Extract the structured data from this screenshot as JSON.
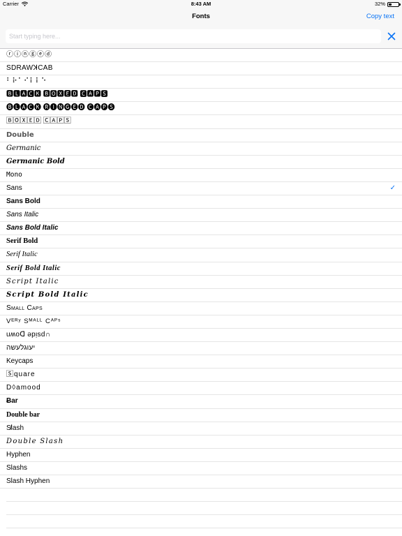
{
  "status_bar": {
    "carrier": "Carrier",
    "time": "8:43 AM",
    "battery_pct": "32%",
    "battery_level": 0.32
  },
  "nav": {
    "title": "Fonts",
    "copy_label": "Copy text"
  },
  "search": {
    "placeholder": "Start typing here...",
    "value": ""
  },
  "fonts": [
    {
      "label": "ⓡⓘⓝⓖⓔⓓ",
      "cls": "f-circled"
    },
    {
      "label": "SDRAWꓘCAB",
      "cls": "f-backwards"
    },
    {
      "label": "⠃⠗⠁⠊⠇⠇⠑",
      "cls": "f-braille"
    },
    {
      "label": "🅱🅻🅰🅲🅺 🅱🅾🆇🅴🅳 🅲🅰🅿🆂",
      "cls": "f-blackbox"
    },
    {
      "label": "🅑🅛🅐🅒🅚 🅡🅘🅝🅖🅔🅓 🅒🅐🅟🅢",
      "cls": "f-blackring"
    },
    {
      "label": "🄱🄾🅇🄴🄳 🄲🄰🄿🅂",
      "cls": "f-boxed"
    },
    {
      "label": "Double",
      "cls": "f-double"
    },
    {
      "label": "Germanic",
      "cls": "f-german"
    },
    {
      "label": "Germanic Bold",
      "cls": "f-germanbold"
    },
    {
      "label": "Mono",
      "cls": "f-mono"
    },
    {
      "label": "Sans",
      "cls": "f-sans",
      "selected": true
    },
    {
      "label": "Sans Bold",
      "cls": "f-sansbold"
    },
    {
      "label": "Sans Italic",
      "cls": "f-sansitalic"
    },
    {
      "label": "Sans Bold Italic",
      "cls": "f-sansbolditalic"
    },
    {
      "label": "Serif Bold",
      "cls": "f-serifbold"
    },
    {
      "label": "Serif Italic",
      "cls": "f-serifitalic"
    },
    {
      "label": "Serif Bold Italic",
      "cls": "f-serifbolditalic"
    },
    {
      "label": "Script Italic",
      "cls": "f-script"
    },
    {
      "label": "Script Bold Italic",
      "cls": "f-scriptbold"
    },
    {
      "label": "Small Caps",
      "cls": "f-smallcaps"
    },
    {
      "label": "Vᴱᴿʸ Sᴹᴬᴸᴸ Cᴬᴾˢ",
      "cls": "f-verysmall"
    },
    {
      "label": "uʍoᗡ ǝpᴉsd∩",
      "cls": "f-upside"
    },
    {
      "label": "יעוגלעשה",
      "cls": "f-hebrew"
    },
    {
      "label": "Keycaps",
      "cls": "f-keycaps"
    },
    {
      "label": "🅂quare",
      "cls": "f-square"
    },
    {
      "label": "D◊amood",
      "cls": "f-diamond"
    },
    {
      "label": "Ƀar",
      "cls": "f-bar"
    },
    {
      "label": "Double bar",
      "cls": "f-doublebar"
    },
    {
      "label": "S̸lash",
      "cls": "f-slash"
    },
    {
      "label": "Double Slash",
      "cls": "f-doubleslash"
    },
    {
      "label": "Hyphen",
      "cls": "f-hyphen"
    },
    {
      "label": "Slashs",
      "cls": "f-slashs"
    },
    {
      "label": "Slash Hyphen",
      "cls": "f-slashhyphen"
    }
  ],
  "colors": {
    "accent": "#0a74f5",
    "bar_bg": "#f7f7f7",
    "separator": "#e5e5e5"
  }
}
